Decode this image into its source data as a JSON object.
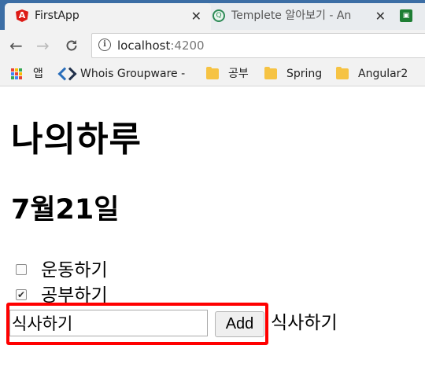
{
  "browser": {
    "tabs": [
      {
        "title": "FirstApp",
        "favicon": "angular-icon",
        "close": "✕",
        "active": true
      },
      {
        "title": "Templete 알아보기 - An",
        "favicon": "circle-app-icon",
        "close": "✕",
        "active": false
      },
      {
        "title": "",
        "favicon": "box-app-icon",
        "active": false
      }
    ],
    "toolbar": {
      "back_icon": "←",
      "forward_icon": "→",
      "reload_icon": "C",
      "info_icon": "i",
      "url_host": "localhost",
      "url_port": ":4200"
    },
    "bookmarks": [
      {
        "label": "앱",
        "icon": "apps-grid-icon"
      },
      {
        "label": "Whois Groupware - ",
        "icon": "whois-logo-icon"
      },
      {
        "label": "공부",
        "icon": "folder-icon"
      },
      {
        "label": "Spring",
        "icon": "folder-icon"
      },
      {
        "label": "Angular2",
        "icon": "folder-icon"
      }
    ],
    "colors": {
      "tabstrip": "#3c6ea5",
      "toolbar": "#f2f2f2",
      "folder": "#f6c343"
    }
  },
  "page": {
    "title": "나의하루",
    "date": "7월21일",
    "todos": [
      {
        "label": "운동하기",
        "checked": false
      },
      {
        "label": "공부하기",
        "checked": true
      }
    ],
    "new_todo_value": "식사하기",
    "add_label": "Add",
    "preview": "식사하기",
    "highlight_color": "#ff0000"
  }
}
